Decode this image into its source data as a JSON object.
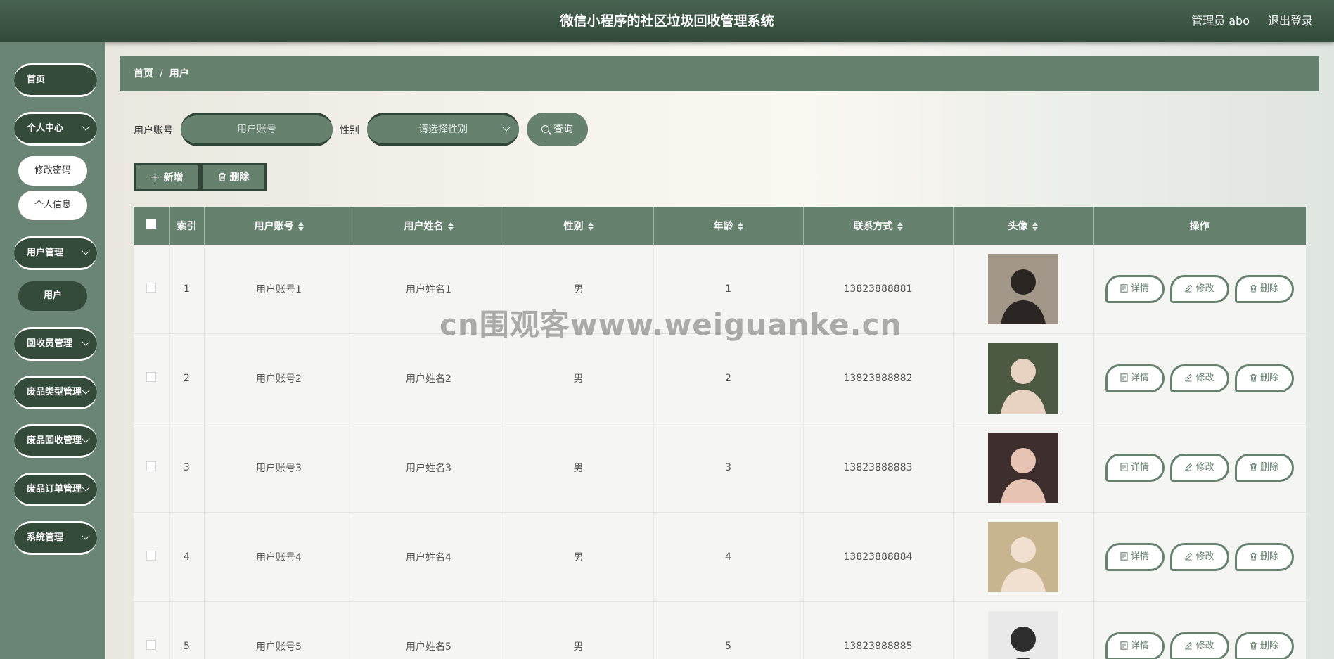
{
  "header": {
    "title": "微信小程序的社区垃圾回收管理系统",
    "user": "管理员 abo",
    "logout": "退出登录"
  },
  "sidebar": {
    "home": "首页",
    "personal": "个人中心",
    "change_password": "修改密码",
    "personal_info": "个人信息",
    "user_mgmt": "用户管理",
    "user": "用户",
    "recycler_mgmt": "回收员管理",
    "waste_type_mgmt": "废品类型管理",
    "waste_recycle_mgmt": "废品回收管理",
    "waste_order_mgmt": "废品订单管理",
    "system_mgmt": "系统管理"
  },
  "breadcrumb": {
    "home": "首页",
    "sep": "/",
    "current": "用户"
  },
  "search": {
    "account_label": "用户账号",
    "account_placeholder": "用户账号",
    "gender_label": "性别",
    "gender_placeholder": "请选择性别",
    "query": "查询"
  },
  "toolbar": {
    "add": "新增",
    "delete": "删除"
  },
  "table": {
    "headers": {
      "index": "索引",
      "account": "用户账号",
      "name": "用户姓名",
      "gender": "性别",
      "age": "年龄",
      "phone": "联系方式",
      "avatar": "头像",
      "actions": "操作"
    },
    "actions": {
      "detail": "详情",
      "edit": "修改",
      "delete": "删除"
    },
    "rows": [
      {
        "index": "1",
        "account": "用户账号1",
        "name": "用户姓名1",
        "gender": "男",
        "age": "1",
        "phone": "13823888881"
      },
      {
        "index": "2",
        "account": "用户账号2",
        "name": "用户姓名2",
        "gender": "男",
        "age": "2",
        "phone": "13823888882"
      },
      {
        "index": "3",
        "account": "用户账号3",
        "name": "用户姓名3",
        "gender": "男",
        "age": "3",
        "phone": "13823888883"
      },
      {
        "index": "4",
        "account": "用户账号4",
        "name": "用户姓名4",
        "gender": "男",
        "age": "4",
        "phone": "13823888884"
      },
      {
        "index": "5",
        "account": "用户账号5",
        "name": "用户姓名5",
        "gender": "男",
        "age": "5",
        "phone": "13823888885"
      }
    ]
  },
  "watermark": "cn围观客www.weiguanke.cn",
  "colors": {
    "header": "#3d5646",
    "sidebar": "#6a8575",
    "accent": "#66826f",
    "dark": "#344a3a"
  }
}
